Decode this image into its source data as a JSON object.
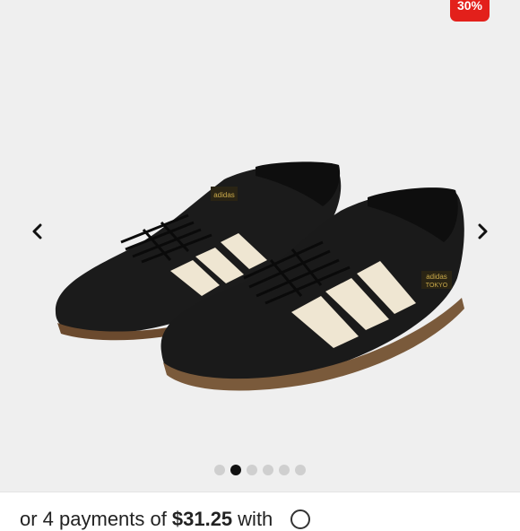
{
  "gallery": {
    "discount_badge": "30%",
    "dot_count": 6,
    "active_dot": 1,
    "shoe_brand_label": "adidas",
    "shoe_model_label": "TOKYO"
  },
  "installment": {
    "prefix": "or 4 payments of",
    "amount": "$31.25",
    "suffix": "with"
  },
  "colors": {
    "badge": "#e3201b",
    "gallery_bg": "#efefef",
    "dot_active": "#111111",
    "dot_inactive": "#cfcfcf"
  },
  "icons": {
    "prev": "chevron-left-icon",
    "next": "chevron-right-icon",
    "info": "info-icon"
  }
}
